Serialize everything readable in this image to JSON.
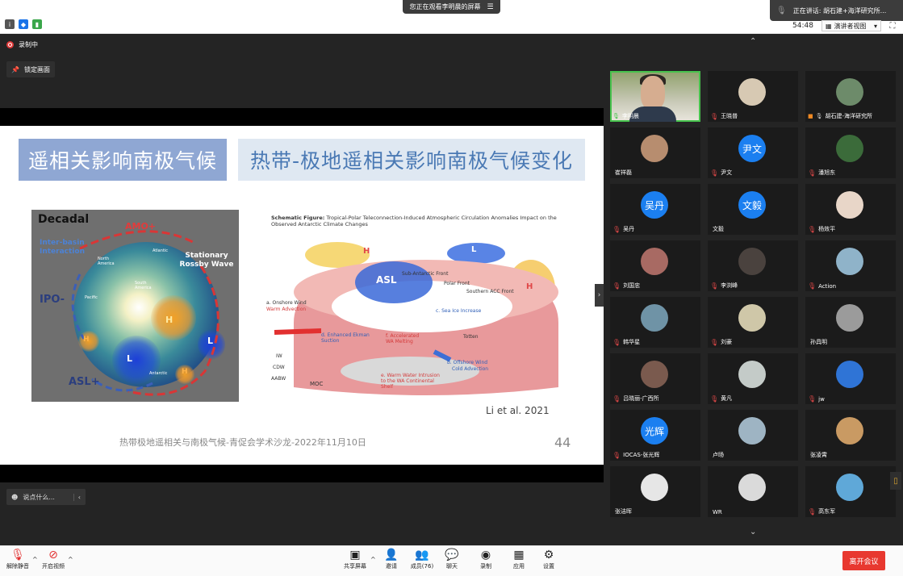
{
  "top": {
    "share_pill": "您正在观看李明晨的屏幕",
    "speaking": "正在讲话: 胡石建+海洋研究所...",
    "timer": "54:48",
    "view_mode": "演讲者视图"
  },
  "main": {
    "recording": "录制中",
    "lock_screen": "锁定画面",
    "chat_placeholder": "说点什么..."
  },
  "slide": {
    "title_left": "遥相关影响南极气候",
    "title_right": "热带-极地遥相关影响南极气候变化",
    "globe": {
      "decadal": "Decadal",
      "amo": "AMO+",
      "ipo": "IPO-",
      "asl": "ASL+",
      "interbasin": "Inter-basin Interaction",
      "stationary": "Stationary Rossby Wave",
      "atlantic": "Atlantic",
      "north_america": "North America",
      "south_america": "South America",
      "pacific": "Pacific",
      "antarctic": "Antarctic",
      "h": "H",
      "l": "L"
    },
    "schematic": {
      "title_bold": "Schematic Figure:",
      "title_rest": "Tropical-Polar Teleconnection-Induced Atmospheric Circulation Anomalies Impact on the Observed Antarctic Climate Changes",
      "onshore": "a. Onshore Wind",
      "warm_adv": "Warm Advection",
      "enhanced": "d. Enhanced Ekman Suction",
      "asl": "ASL",
      "sea_ice": "c. Sea Ice Increase",
      "accel": "f. Accelerated WA Melting",
      "offshore": "b. Offshore Wind",
      "cold_adv": "Cold Advection",
      "warm_water": "e. Warm Water Intrusion to the WA Continental Shelf",
      "saf": "Sub-Antarctic Front",
      "pf": "Polar Front",
      "sacc": "Southern ACC Front",
      "iw": "IW",
      "cdw": "CDW",
      "aabw": "AABW",
      "moc": "MOC",
      "totten": "Totten",
      "h": "H",
      "l": "L"
    },
    "citation": "Li et al. 2021",
    "footer": "热带极地遥相关与南极气候-青促会学术沙龙-2022年11月10日",
    "page_number": "44"
  },
  "participants": [
    {
      "name": "李明晨",
      "type": "video",
      "avatar_text": "",
      "color": "",
      "muted": false,
      "active": true
    },
    {
      "name": "王晓普",
      "type": "photo",
      "avatar_text": "",
      "color": "#d7c9b3",
      "muted": true
    },
    {
      "name": "胡石建-海洋研究所",
      "type": "photo",
      "avatar_text": "",
      "color": "#6d8b6a",
      "muted": false,
      "host": true
    },
    {
      "name": "崔祥磊",
      "type": "photo",
      "avatar_text": "",
      "color": "#b78d6f",
      "muted": false
    },
    {
      "name": "尹文",
      "type": "initial",
      "avatar_text": "尹文",
      "color": "#1b7ff0",
      "muted": true
    },
    {
      "name": "潘旭东",
      "type": "photo",
      "avatar_text": "",
      "color": "#3b6b3a",
      "muted": true
    },
    {
      "name": "吴丹",
      "type": "initial",
      "avatar_text": "吴丹",
      "color": "#1b7ff0",
      "muted": true
    },
    {
      "name": "文毅",
      "type": "initial",
      "avatar_text": "文毅",
      "color": "#1b7ff0",
      "muted": false
    },
    {
      "name": "杨效平",
      "type": "photo",
      "avatar_text": "",
      "color": "#e8d6c8",
      "muted": true
    },
    {
      "name": "刘国忠",
      "type": "photo",
      "avatar_text": "",
      "color": "#a86a63",
      "muted": true
    },
    {
      "name": "李浏峰",
      "type": "photo",
      "avatar_text": "",
      "color": "#4a423e",
      "muted": true
    },
    {
      "name": "Action",
      "type": "photo",
      "avatar_text": "",
      "color": "#8fb3c9",
      "muted": true
    },
    {
      "name": "韩华星",
      "type": "photo",
      "avatar_text": "",
      "color": "#6f93a6",
      "muted": true
    },
    {
      "name": "刘豪",
      "type": "photo",
      "avatar_text": "",
      "color": "#cfc7a8",
      "muted": true
    },
    {
      "name": "孙具明",
      "type": "photo",
      "avatar_text": "",
      "color": "#9b9b9b",
      "muted": false
    },
    {
      "name": "吕晓丽-广西所",
      "type": "photo",
      "avatar_text": "",
      "color": "#7a5a4e",
      "muted": true
    },
    {
      "name": "黄凡",
      "type": "photo",
      "avatar_text": "",
      "color": "#c4cbc8",
      "muted": true
    },
    {
      "name": "jw",
      "type": "photo",
      "avatar_text": "",
      "color": "#2f74d6",
      "muted": true
    },
    {
      "name": "IOCAS-张光辉",
      "type": "initial",
      "avatar_text": "光辉",
      "color": "#1b7ff0",
      "muted": true
    },
    {
      "name": "卢旸",
      "type": "photo",
      "avatar_text": "",
      "color": "#9eb4c3",
      "muted": false
    },
    {
      "name": "张凌霄",
      "type": "photo",
      "avatar_text": "",
      "color": "#c99a63",
      "muted": false
    },
    {
      "name": "张洁晖",
      "type": "photo",
      "avatar_text": "",
      "color": "#e6e6e6",
      "muted": false
    },
    {
      "name": "WR",
      "type": "photo",
      "avatar_text": "",
      "color": "#dadada",
      "muted": false
    },
    {
      "name": "高东军",
      "type": "photo",
      "avatar_text": "",
      "color": "#5fa8d8",
      "muted": true
    }
  ],
  "toolbar": {
    "mute": "解除静音",
    "video": "开启视频",
    "share": "共享屏幕",
    "invite": "邀请",
    "members": "成员(76)",
    "chat": "聊天",
    "record": "录制",
    "apps": "应用",
    "settings": "设置",
    "leave": "离开会议"
  }
}
